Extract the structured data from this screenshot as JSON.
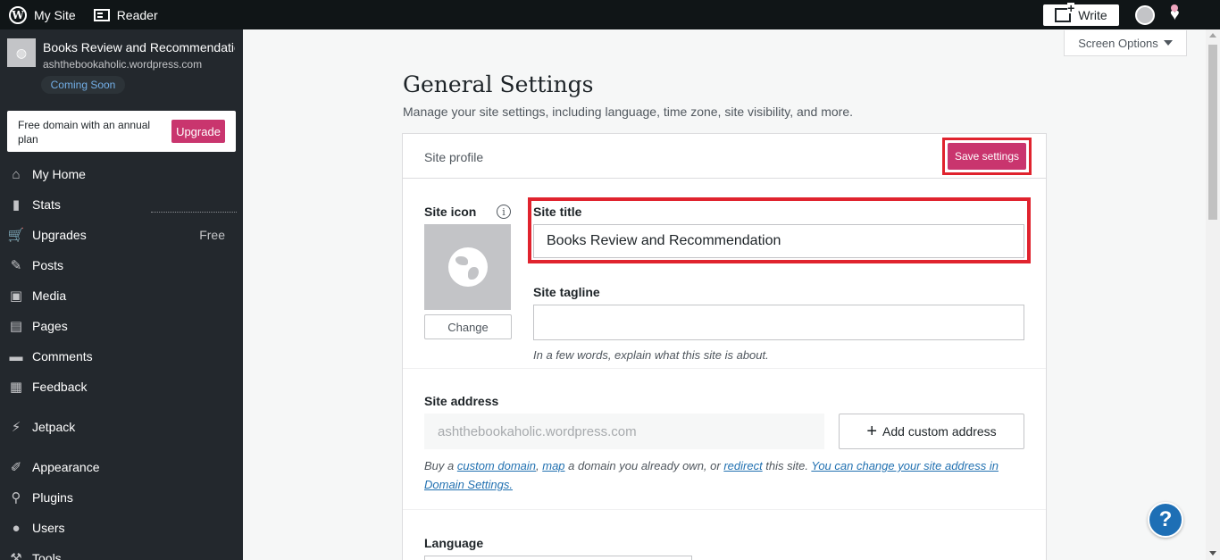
{
  "topbar": {
    "my_site": "My Site",
    "reader": "Reader",
    "write": "Write"
  },
  "sidebar": {
    "site_name": "Books Review and Recommendation",
    "site_url": "ashthebookaholic.wordpress.com",
    "status_badge": "Coming Soon",
    "upsell_text": "Free domain with an annual plan",
    "upgrade": "Upgrade",
    "items": [
      {
        "label": "My Home",
        "icon": "home-icon",
        "glyph": "⌂"
      },
      {
        "label": "Stats",
        "icon": "stats-icon",
        "glyph": "▮"
      },
      {
        "label": "Upgrades",
        "icon": "cart-icon",
        "glyph": "🛒",
        "badge": "Free"
      },
      {
        "label": "Posts",
        "icon": "pin-icon",
        "glyph": "✎"
      },
      {
        "label": "Media",
        "icon": "media-icon",
        "glyph": "▣"
      },
      {
        "label": "Pages",
        "icon": "pages-icon",
        "glyph": "▤"
      },
      {
        "label": "Comments",
        "icon": "comment-icon",
        "glyph": "▬"
      },
      {
        "label": "Feedback",
        "icon": "feedback-icon",
        "glyph": "▦"
      },
      {
        "label": "Jetpack",
        "icon": "jetpack-icon",
        "glyph": "⚡"
      },
      {
        "label": "Appearance",
        "icon": "brush-icon",
        "glyph": "✐"
      },
      {
        "label": "Plugins",
        "icon": "plug-icon",
        "glyph": "⚲"
      },
      {
        "label": "Users",
        "icon": "user-icon",
        "glyph": "●"
      },
      {
        "label": "Tools",
        "icon": "tools-icon",
        "glyph": "⚒"
      }
    ]
  },
  "main": {
    "screen_options": "Screen Options",
    "title": "General Settings",
    "subtitle": "Manage your site settings, including language, time zone, site visibility, and more.",
    "card_header": "Site profile",
    "save": "Save settings",
    "site_icon_label": "Site icon",
    "change": "Change",
    "site_title_label": "Site title",
    "site_title_value": "Books Review and Recommendation",
    "tagline_label": "Site tagline",
    "tagline_value": "",
    "tagline_hint": "In a few words, explain what this site is about.",
    "address_label": "Site address",
    "address_value": "ashthebookaholic.wordpress.com",
    "add_custom": "Add custom address",
    "help": {
      "t1": "Buy a ",
      "link1": "custom domain",
      "t2": ", ",
      "link2": "map",
      "t3": " a domain you already own, or ",
      "link3": "redirect",
      "t4": " this site. ",
      "link4": "You can change your site address in Domain Settings."
    },
    "language_label": "Language"
  },
  "colors": {
    "accent": "#c9356e",
    "highlight": "#e0232e",
    "link": "#2271b1",
    "sidebar": "#23282d"
  }
}
